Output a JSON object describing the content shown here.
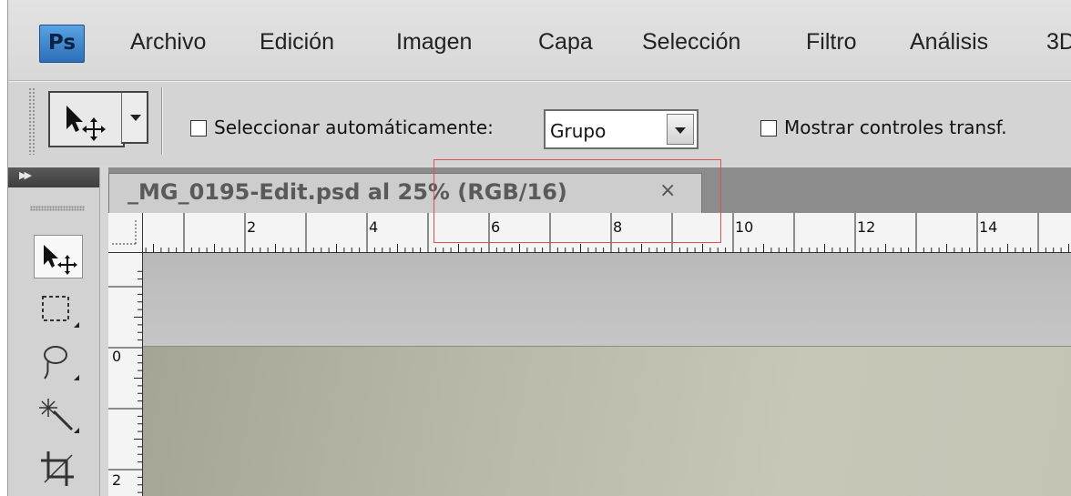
{
  "app": {
    "logo": "Ps",
    "menu": [
      "Archivo",
      "Edición",
      "Imagen",
      "Capa",
      "Selección",
      "Filtro",
      "Análisis",
      "3D"
    ]
  },
  "options_bar": {
    "auto_select_label": "Seleccionar automáticamente:",
    "auto_select_checked": false,
    "auto_select_value": "Grupo",
    "show_transform_label": "Mostrar controles transf.",
    "show_transform_checked": false
  },
  "document": {
    "tab_title": "_MG_0195-Edit.psd al 25% (RGB/16)",
    "close_glyph": "×",
    "hruler_labels": [
      "2",
      "4",
      "6",
      "8",
      "10",
      "12",
      "14"
    ],
    "vruler_labels": [
      "0",
      "2"
    ]
  },
  "tools": [
    "move-tool",
    "rectangular-marquee-tool",
    "lasso-tool",
    "magic-wand-tool",
    "crop-tool"
  ],
  "colors": {
    "highlight": "#e05050",
    "ps_logo": "#2c6fb8"
  }
}
